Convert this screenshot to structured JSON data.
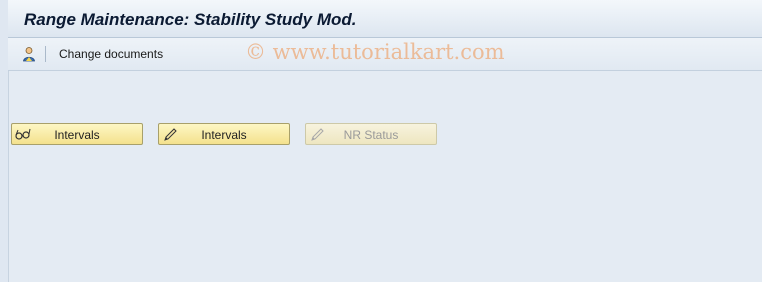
{
  "window": {
    "title": "Range Maintenance: Stability Study Mod."
  },
  "toolbar": {
    "change_documents": {
      "icon": "person-icon",
      "label": "Change documents"
    }
  },
  "watermark": "© www.tutorialkart.com",
  "buttons": [
    {
      "icon": "glasses-icon",
      "label": "Intervals",
      "enabled": true
    },
    {
      "icon": "pencil-icon",
      "label": "Intervals",
      "enabled": true
    },
    {
      "icon": "pencil-icon",
      "label": "NR Status",
      "enabled": false
    }
  ],
  "colors": {
    "background": "#e4ebf3",
    "button_fill": "#f8ea9f",
    "watermark": "#ecaa78"
  }
}
